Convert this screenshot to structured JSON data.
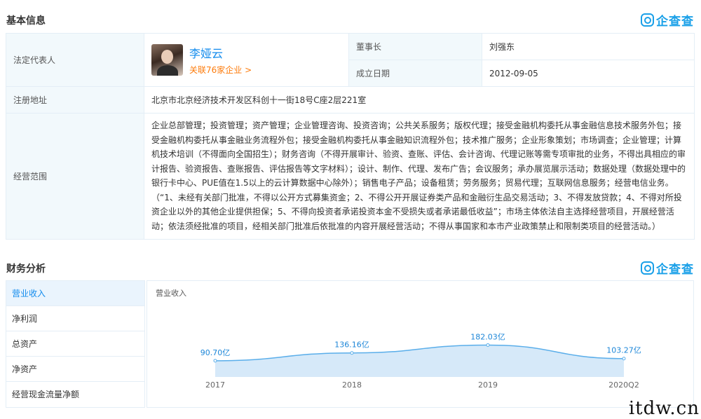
{
  "basic": {
    "title": "基本信息",
    "logo_text": "企查查",
    "legal_rep_label": "法定代表人",
    "legal_rep_name": "李娅云",
    "legal_rep_link": "关联76家企业 >",
    "chairman_label": "董事长",
    "chairman_value": "刘强东",
    "founded_label": "成立日期",
    "founded_value": "2012-09-05",
    "address_label": "注册地址",
    "address_value": "北京市北京经济技术开发区科创十一街18号C座2层221室",
    "scope_label": "经营范围",
    "scope_value": "企业总部管理；投资管理；资产管理；企业管理咨询、投资咨询；公共关系服务；版权代理；接受金融机构委托从事金融信息技术服务外包；接受金融机构委托从事金融业务流程外包；接受金融机构委托从事金融知识流程外包；技术推广服务；企业形象策划；市场调查；企业管理；计算机技术培训（不得面向全国招生）；财务咨询（不得开展审计、验资、查账、评估、会计咨询、代理记账等需专项审批的业务，不得出具相应的审计报告、验资报告、查账报告、评估报告等文字材料）；设计、制作、代理、发布广告；会议服务；承办展览展示活动；数据处理（数据处理中的银行卡中心、PUE值在1.5以上的云计算数据中心除外）；销售电子产品；设备租赁；劳务服务；贸易代理；互联网信息服务；经营电信业务。（“1、未经有关部门批准，不得以公开方式募集资金；2、不得公开开展证券类产品和金融衍生品交易活动；3、不得发放贷款；4、不得对所投资企业以外的其他企业提供担保；5、不得向投资者承诺投资本金不受损失或者承诺最低收益”；市场主体依法自主选择经营项目，开展经营活动；依法须经批准的项目，经相关部门批准后依批准的内容开展经营活动；不得从事国家和本市产业政策禁止和限制类项目的经营活动。）"
  },
  "finance": {
    "title": "财务分析",
    "logo_text": "企查查",
    "tabs": [
      "营业收入",
      "净利润",
      "总资产",
      "净资产",
      "经营现金流量净额"
    ],
    "active_tab": 0
  },
  "chart_data": {
    "type": "area",
    "title": "营业收入",
    "categories": [
      "2017",
      "2018",
      "2019",
      "2020Q2"
    ],
    "values": [
      90.7,
      136.16,
      182.03,
      103.27
    ],
    "value_labels": [
      "90.70亿",
      "136.16亿",
      "182.03亿",
      "103.27亿"
    ],
    "color": "#5aaeea",
    "fill": "#cfe5f8"
  },
  "watermark": "itdw.cn"
}
